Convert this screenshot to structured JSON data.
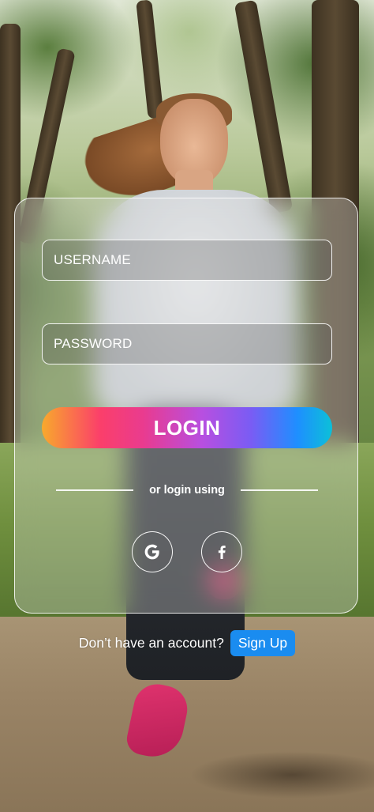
{
  "login_form": {
    "username_placeholder": "USERNAME",
    "password_placeholder": "PASSWORD",
    "login_label": "LOGIN",
    "divider_text": "or login using",
    "social": [
      {
        "icon": "google-icon"
      },
      {
        "icon": "facebook-icon"
      }
    ]
  },
  "footer": {
    "prompt": "Don’t have an account?",
    "signup_label": "Sign Up"
  },
  "colors": {
    "signup_button": "#1a8cf0",
    "login_gradient": [
      "#f8a92c",
      "#fb3f6a",
      "#b84fe0",
      "#1e8fff",
      "#0cc0d8"
    ],
    "text": "#ffffff"
  }
}
